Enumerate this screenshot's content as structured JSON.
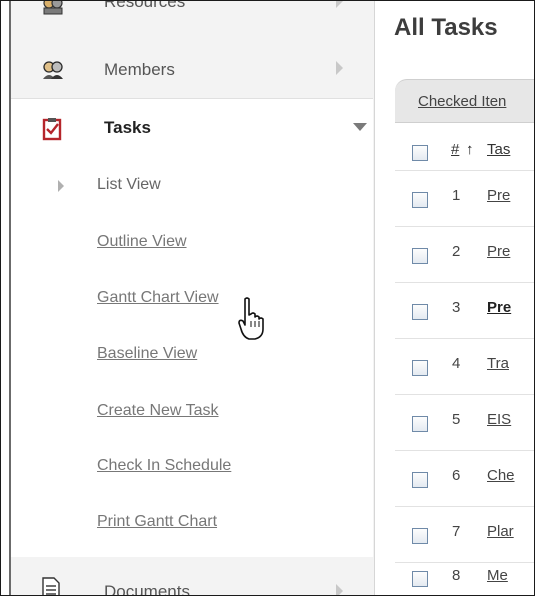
{
  "sidebar": {
    "items": [
      {
        "label": "Resources",
        "icon": "resources-icon"
      },
      {
        "label": "Members",
        "icon": "members-icon"
      },
      {
        "label": "Tasks",
        "icon": "tasks-icon"
      },
      {
        "label": "Documents",
        "icon": "documents-icon"
      }
    ],
    "task_subitems": [
      {
        "label": "List View"
      },
      {
        "label": "Outline View"
      },
      {
        "label": "Gantt Chart View"
      },
      {
        "label": "Baseline View"
      },
      {
        "label": "Create New Task"
      },
      {
        "label": "Check In Schedule"
      },
      {
        "label": "Print Gantt Chart"
      }
    ]
  },
  "main": {
    "title": "All Tasks",
    "toolbar_link": "Checked Iten",
    "columns": {
      "number": "#",
      "sort_arrow": "↑",
      "task": "Tas"
    },
    "rows": [
      {
        "num": "1",
        "task": "Pre"
      },
      {
        "num": "2",
        "task": "Pre"
      },
      {
        "num": "3",
        "task": "Pre"
      },
      {
        "num": "4",
        "task": "Tra"
      },
      {
        "num": "5",
        "task": "EIS"
      },
      {
        "num": "6",
        "task": "Che"
      },
      {
        "num": "7",
        "task": "Plar"
      },
      {
        "num": "8",
        "task": "Me"
      }
    ]
  },
  "colors": {
    "accent_icon": "#b5252b",
    "sidebar_bg": "#f3f3f3",
    "toolbar_bg": "#e7e7e7"
  }
}
